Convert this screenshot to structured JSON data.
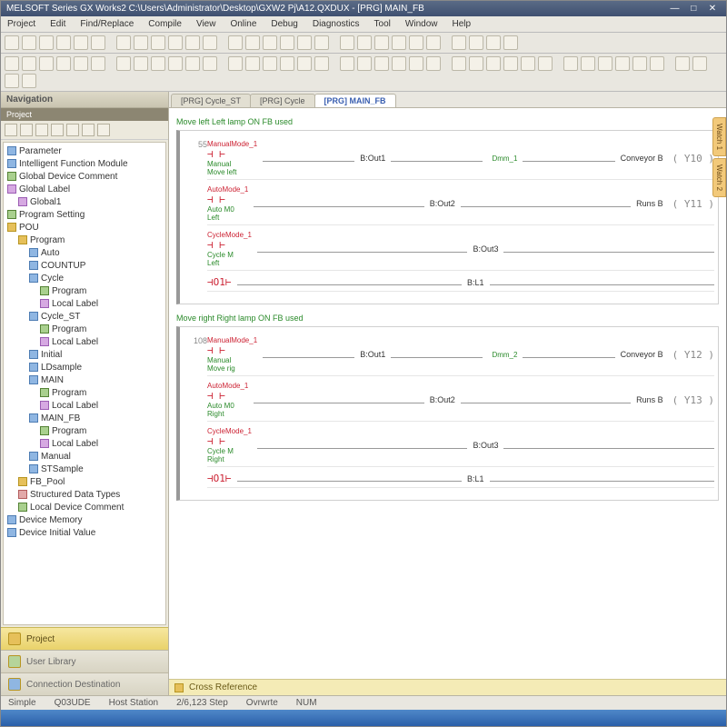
{
  "title": "MELSOFT Series GX Works2 C:\\Users\\Administrator\\Desktop\\GXW2 Pj\\A12.QXDUX - [PRG] MAIN_FB",
  "menu": [
    "Project",
    "Edit",
    "Find/Replace",
    "Compile",
    "View",
    "Online",
    "Debug",
    "Diagnostics",
    "Tool",
    "Window",
    "Help"
  ],
  "nav": {
    "header": "Navigation",
    "sub": "Project",
    "items": [
      {
        "t": "Parameter",
        "d": 0,
        "c": "b"
      },
      {
        "t": "Intelligent Function Module",
        "d": 0,
        "c": "b"
      },
      {
        "t": "Global Device Comment",
        "d": 0,
        "c": "g"
      },
      {
        "t": "Global Label",
        "d": 0,
        "c": "p"
      },
      {
        "t": "Global1",
        "d": 1,
        "c": "p"
      },
      {
        "t": "Program Setting",
        "d": 0,
        "c": "g"
      },
      {
        "t": "POU",
        "d": 0,
        "c": ""
      },
      {
        "t": "Program",
        "d": 1,
        "c": ""
      },
      {
        "t": "Auto",
        "d": 2,
        "c": "b"
      },
      {
        "t": "COUNTUP",
        "d": 2,
        "c": "b"
      },
      {
        "t": "Cycle",
        "d": 2,
        "c": "b"
      },
      {
        "t": "Program",
        "d": 3,
        "c": "g"
      },
      {
        "t": "Local Label",
        "d": 3,
        "c": "p"
      },
      {
        "t": "Cycle_ST",
        "d": 2,
        "c": "b"
      },
      {
        "t": "Program",
        "d": 3,
        "c": "g"
      },
      {
        "t": "Local Label",
        "d": 3,
        "c": "p"
      },
      {
        "t": "Initial",
        "d": 2,
        "c": "b"
      },
      {
        "t": "LDsample",
        "d": 2,
        "c": "b"
      },
      {
        "t": "MAIN",
        "d": 2,
        "c": "b"
      },
      {
        "t": "Program",
        "d": 3,
        "c": "g"
      },
      {
        "t": "Local Label",
        "d": 3,
        "c": "p"
      },
      {
        "t": "MAIN_FB",
        "d": 2,
        "c": "b"
      },
      {
        "t": "Program",
        "d": 3,
        "c": "g"
      },
      {
        "t": "Local Label",
        "d": 3,
        "c": "p"
      },
      {
        "t": "Manual",
        "d": 2,
        "c": "b"
      },
      {
        "t": "STSample",
        "d": 2,
        "c": "b"
      },
      {
        "t": "FB_Pool",
        "d": 1,
        "c": ""
      },
      {
        "t": "Structured Data Types",
        "d": 1,
        "c": "r"
      },
      {
        "t": "Local Device Comment",
        "d": 1,
        "c": "g"
      },
      {
        "t": "Device Memory",
        "d": 0,
        "c": "b"
      },
      {
        "t": "Device Initial Value",
        "d": 0,
        "c": "b"
      }
    ],
    "bottom": [
      {
        "t": "Project"
      },
      {
        "t": "User Library"
      },
      {
        "t": "Connection Destination"
      }
    ]
  },
  "tabs": [
    {
      "t": "[PRG] Cycle_ST",
      "a": false
    },
    {
      "t": "[PRG] Cycle",
      "a": false
    },
    {
      "t": "[PRG] MAIN_FB",
      "a": true
    }
  ],
  "sections": [
    {
      "comment": "Move left  Left lamp ON  FB used",
      "rungs": [
        {
          "n": "55",
          "c": {
            "name": "ManualMode_1",
            "top": "",
            "s1": "Manual",
            "s2": "Move left"
          },
          "mid": "B:Out1",
          "topc": "Dmm_1",
          "out": "Conveyor B",
          "coil": "Y10"
        },
        {
          "n": "",
          "c": {
            "name": "AutoMode_1",
            "top": "",
            "s1": "Auto M0",
            "s2": "Left"
          },
          "mid": "B:Out2",
          "topc": "",
          "out": "Runs B",
          "coil": "Y11"
        },
        {
          "n": "",
          "c": {
            "name": "CycleMode_1",
            "top": "",
            "s1": "Cycle M",
            "s2": "Left"
          },
          "mid": "B:Out3",
          "topc": "",
          "out": "",
          "coil": ""
        },
        {
          "n": "",
          "c": {
            "name": "",
            "top": "O1",
            "s1": "",
            "s2": ""
          },
          "mid": "B:L1",
          "topc": "",
          "out": "",
          "coil": ""
        }
      ]
    },
    {
      "comment": "Move right  Right lamp ON  FB used",
      "rungs": [
        {
          "n": "108",
          "c": {
            "name": "ManualMode_1",
            "top": "",
            "s1": "Manual",
            "s2": "Move rig"
          },
          "mid": "B:Out1",
          "topc": "Dmm_2",
          "out": "Conveyor B",
          "coil": "Y12"
        },
        {
          "n": "",
          "c": {
            "name": "AutoMode_1",
            "top": "",
            "s1": "Auto M0",
            "s2": "Right"
          },
          "mid": "B:Out2",
          "topc": "",
          "out": "Runs B",
          "coil": "Y13"
        },
        {
          "n": "",
          "c": {
            "name": "CycleMode_1",
            "top": "",
            "s1": "Cycle M",
            "s2": "Right"
          },
          "mid": "B:Out3",
          "topc": "",
          "out": "",
          "coil": ""
        },
        {
          "n": "",
          "c": {
            "name": "",
            "top": "O1",
            "s1": "",
            "s2": ""
          },
          "mid": "B:L1",
          "topc": "",
          "out": "",
          "coil": ""
        }
      ]
    }
  ],
  "sidetabs": [
    "Watch 1",
    "Watch 2"
  ],
  "cross": "Cross Reference",
  "status": [
    "Simple",
    "Q03UDE",
    "Host Station",
    "2/6,123 Step",
    "Ovrwrte",
    "NUM"
  ]
}
